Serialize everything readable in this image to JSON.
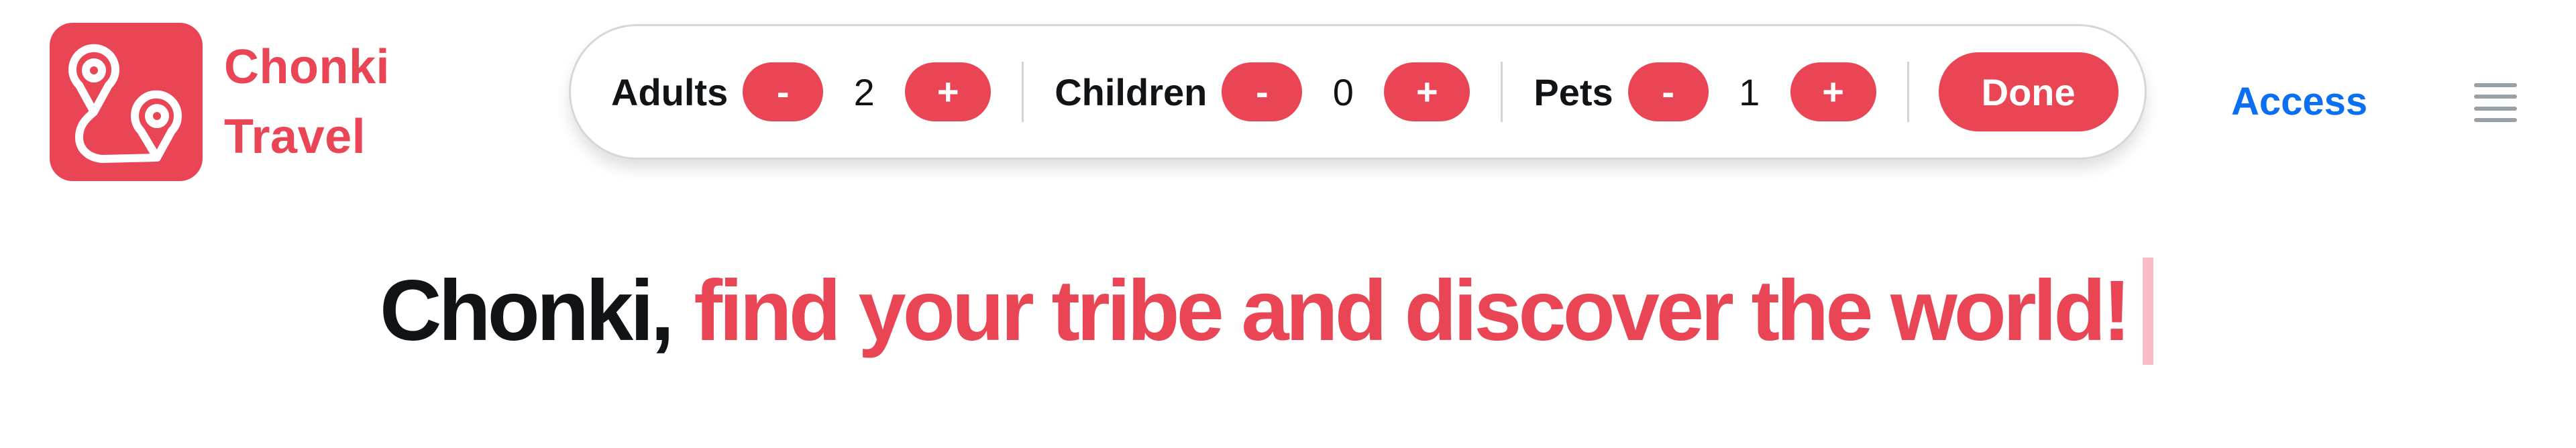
{
  "brand": {
    "name_line1": "Chonki",
    "name_line2": "Travel",
    "logo_icon": "route-map-pins-icon",
    "accent_color": "#e94555"
  },
  "guest_selector": {
    "groups": [
      {
        "label": "Adults",
        "count": "2",
        "decrement_label": "-",
        "increment_label": "+"
      },
      {
        "label": "Children",
        "count": "0",
        "decrement_label": "-",
        "increment_label": "+"
      },
      {
        "label": "Pets",
        "count": "1",
        "decrement_label": "-",
        "increment_label": "+"
      }
    ],
    "done_label": "Done"
  },
  "nav": {
    "access_label": "Access",
    "access_color": "#0a6ff2",
    "menu_icon": "hamburger-menu-icon"
  },
  "hero": {
    "headline_prefix": "Chonki,",
    "headline_accent": "find your tribe and discover the world!"
  }
}
